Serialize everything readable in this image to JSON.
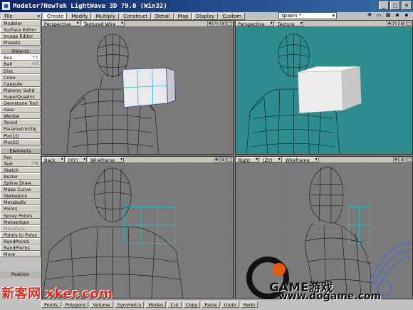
{
  "window": {
    "title": "Modeler?NewTek LightWave 3D ?9.0 (Win32)"
  },
  "toolbar": {
    "file_label": "File",
    "tabs": [
      "Create",
      "Modify",
      "Multiply",
      "Construct",
      "Detail",
      "Map",
      "Display",
      "Custom"
    ],
    "active_tab": "Create",
    "spawn_value": "spawn *"
  },
  "sidebar": {
    "menus": [
      "Modeler",
      "Surface Editor",
      "Image Editor",
      "Presets"
    ],
    "objects_header": "Objects",
    "objects": [
      {
        "label": "Box",
        "shortcut": "+X"
      },
      {
        "label": "Ball",
        "shortcut": "+O"
      },
      {
        "label": "Disc",
        "shortcut": ""
      },
      {
        "label": "Cone",
        "shortcut": ""
      },
      {
        "label": "Capsule",
        "shortcut": ""
      },
      {
        "label": "Platonic Solid",
        "shortcut": ""
      },
      {
        "label": "SuperQuadric",
        "shortcut": ""
      },
      {
        "label": "Gemstone Tool",
        "shortcut": ""
      },
      {
        "label": "Gear",
        "shortcut": ""
      },
      {
        "label": "Wedge",
        "shortcut": ""
      },
      {
        "label": "Toroid",
        "shortcut": ""
      },
      {
        "label": "ParametricObj",
        "shortcut": ""
      },
      {
        "label": "Plot1D",
        "shortcut": ""
      },
      {
        "label": "Plot2D",
        "shortcut": ""
      }
    ],
    "elements_header": "Elements",
    "elements": [
      {
        "label": "Pen",
        "shortcut": ""
      },
      {
        "label": "Text",
        "shortcut": "+W"
      },
      {
        "label": "Sketch",
        "shortcut": ""
      },
      {
        "label": "Bezier",
        "shortcut": ""
      },
      {
        "label": "Spline Draw",
        "shortcut": ""
      },
      {
        "label": "Make Curve",
        "shortcut": ""
      },
      {
        "label": "Skelegons",
        "shortcut": ""
      },
      {
        "label": "Metaballs",
        "shortcut": ""
      },
      {
        "label": "Points",
        "shortcut": ""
      },
      {
        "label": "Spray Points",
        "shortcut": ""
      },
      {
        "label": "Metaedges",
        "shortcut": ""
      },
      {
        "label": "Metaface",
        "shortcut": ""
      },
      {
        "label": "Points to Polys",
        "shortcut": ""
      },
      {
        "label": "RandPoints",
        "shortcut": ""
      },
      {
        "label": "RandPlocks",
        "shortcut": ""
      },
      {
        "label": "More",
        "shortcut": ""
      }
    ],
    "position_label": "Position"
  },
  "viewports": {
    "top_left": {
      "view": "Perspective",
      "mode": "Textured Wire"
    },
    "top_right": {
      "view": "Perspective",
      "mode": "Texture"
    },
    "bottom_left": {
      "view": "Back",
      "axis": "(XY)",
      "mode": "Wireframe"
    },
    "bottom_right": {
      "view": "Right",
      "axis": "(ZY)",
      "mode": "Wireframe"
    }
  },
  "bottombar": {
    "items": [
      "Points",
      "Polygons",
      "Volume",
      "Symmetry",
      "Modes",
      "Cut",
      "Copy",
      "Paste",
      "Undo",
      "Redo"
    ]
  },
  "watermarks": {
    "left": "新客网 xker.com",
    "ogame": "GAME游戏",
    "ogame_url": "www.dogame.com"
  },
  "colors": {
    "teal_viewport": "#2e8c8c",
    "gray_viewport": "#7a7a7a",
    "accent_cyan": "#00e5e5"
  }
}
